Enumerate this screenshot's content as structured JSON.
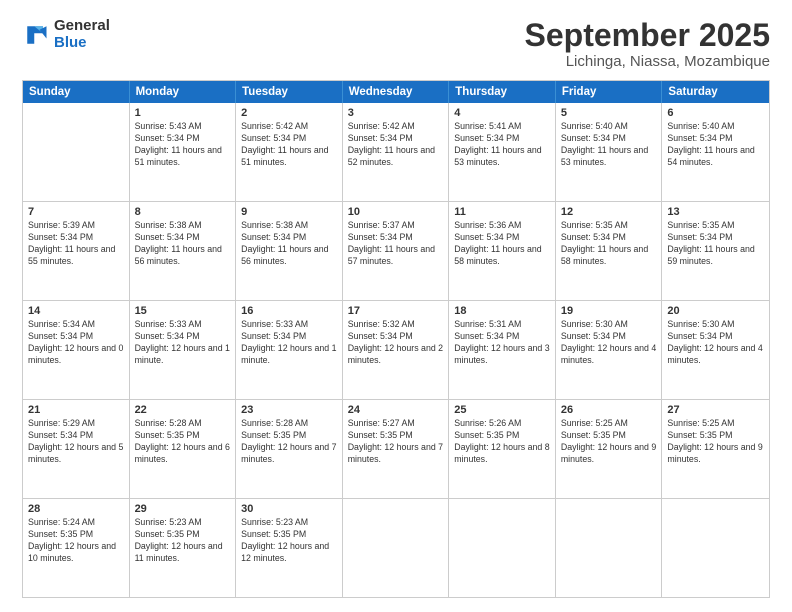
{
  "logo": {
    "general": "General",
    "blue": "Blue"
  },
  "title": {
    "month": "September 2025",
    "location": "Lichinga, Niassa, Mozambique"
  },
  "headers": [
    "Sunday",
    "Monday",
    "Tuesday",
    "Wednesday",
    "Thursday",
    "Friday",
    "Saturday"
  ],
  "rows": [
    [
      {
        "day": "",
        "sunrise": "",
        "sunset": "",
        "daylight": ""
      },
      {
        "day": "1",
        "sunrise": "Sunrise: 5:43 AM",
        "sunset": "Sunset: 5:34 PM",
        "daylight": "Daylight: 11 hours and 51 minutes."
      },
      {
        "day": "2",
        "sunrise": "Sunrise: 5:42 AM",
        "sunset": "Sunset: 5:34 PM",
        "daylight": "Daylight: 11 hours and 51 minutes."
      },
      {
        "day": "3",
        "sunrise": "Sunrise: 5:42 AM",
        "sunset": "Sunset: 5:34 PM",
        "daylight": "Daylight: 11 hours and 52 minutes."
      },
      {
        "day": "4",
        "sunrise": "Sunrise: 5:41 AM",
        "sunset": "Sunset: 5:34 PM",
        "daylight": "Daylight: 11 hours and 53 minutes."
      },
      {
        "day": "5",
        "sunrise": "Sunrise: 5:40 AM",
        "sunset": "Sunset: 5:34 PM",
        "daylight": "Daylight: 11 hours and 53 minutes."
      },
      {
        "day": "6",
        "sunrise": "Sunrise: 5:40 AM",
        "sunset": "Sunset: 5:34 PM",
        "daylight": "Daylight: 11 hours and 54 minutes."
      }
    ],
    [
      {
        "day": "7",
        "sunrise": "Sunrise: 5:39 AM",
        "sunset": "Sunset: 5:34 PM",
        "daylight": "Daylight: 11 hours and 55 minutes."
      },
      {
        "day": "8",
        "sunrise": "Sunrise: 5:38 AM",
        "sunset": "Sunset: 5:34 PM",
        "daylight": "Daylight: 11 hours and 56 minutes."
      },
      {
        "day": "9",
        "sunrise": "Sunrise: 5:38 AM",
        "sunset": "Sunset: 5:34 PM",
        "daylight": "Daylight: 11 hours and 56 minutes."
      },
      {
        "day": "10",
        "sunrise": "Sunrise: 5:37 AM",
        "sunset": "Sunset: 5:34 PM",
        "daylight": "Daylight: 11 hours and 57 minutes."
      },
      {
        "day": "11",
        "sunrise": "Sunrise: 5:36 AM",
        "sunset": "Sunset: 5:34 PM",
        "daylight": "Daylight: 11 hours and 58 minutes."
      },
      {
        "day": "12",
        "sunrise": "Sunrise: 5:35 AM",
        "sunset": "Sunset: 5:34 PM",
        "daylight": "Daylight: 11 hours and 58 minutes."
      },
      {
        "day": "13",
        "sunrise": "Sunrise: 5:35 AM",
        "sunset": "Sunset: 5:34 PM",
        "daylight": "Daylight: 11 hours and 59 minutes."
      }
    ],
    [
      {
        "day": "14",
        "sunrise": "Sunrise: 5:34 AM",
        "sunset": "Sunset: 5:34 PM",
        "daylight": "Daylight: 12 hours and 0 minutes."
      },
      {
        "day": "15",
        "sunrise": "Sunrise: 5:33 AM",
        "sunset": "Sunset: 5:34 PM",
        "daylight": "Daylight: 12 hours and 1 minute."
      },
      {
        "day": "16",
        "sunrise": "Sunrise: 5:33 AM",
        "sunset": "Sunset: 5:34 PM",
        "daylight": "Daylight: 12 hours and 1 minute."
      },
      {
        "day": "17",
        "sunrise": "Sunrise: 5:32 AM",
        "sunset": "Sunset: 5:34 PM",
        "daylight": "Daylight: 12 hours and 2 minutes."
      },
      {
        "day": "18",
        "sunrise": "Sunrise: 5:31 AM",
        "sunset": "Sunset: 5:34 PM",
        "daylight": "Daylight: 12 hours and 3 minutes."
      },
      {
        "day": "19",
        "sunrise": "Sunrise: 5:30 AM",
        "sunset": "Sunset: 5:34 PM",
        "daylight": "Daylight: 12 hours and 4 minutes."
      },
      {
        "day": "20",
        "sunrise": "Sunrise: 5:30 AM",
        "sunset": "Sunset: 5:34 PM",
        "daylight": "Daylight: 12 hours and 4 minutes."
      }
    ],
    [
      {
        "day": "21",
        "sunrise": "Sunrise: 5:29 AM",
        "sunset": "Sunset: 5:34 PM",
        "daylight": "Daylight: 12 hours and 5 minutes."
      },
      {
        "day": "22",
        "sunrise": "Sunrise: 5:28 AM",
        "sunset": "Sunset: 5:35 PM",
        "daylight": "Daylight: 12 hours and 6 minutes."
      },
      {
        "day": "23",
        "sunrise": "Sunrise: 5:28 AM",
        "sunset": "Sunset: 5:35 PM",
        "daylight": "Daylight: 12 hours and 7 minutes."
      },
      {
        "day": "24",
        "sunrise": "Sunrise: 5:27 AM",
        "sunset": "Sunset: 5:35 PM",
        "daylight": "Daylight: 12 hours and 7 minutes."
      },
      {
        "day": "25",
        "sunrise": "Sunrise: 5:26 AM",
        "sunset": "Sunset: 5:35 PM",
        "daylight": "Daylight: 12 hours and 8 minutes."
      },
      {
        "day": "26",
        "sunrise": "Sunrise: 5:25 AM",
        "sunset": "Sunset: 5:35 PM",
        "daylight": "Daylight: 12 hours and 9 minutes."
      },
      {
        "day": "27",
        "sunrise": "Sunrise: 5:25 AM",
        "sunset": "Sunset: 5:35 PM",
        "daylight": "Daylight: 12 hours and 9 minutes."
      }
    ],
    [
      {
        "day": "28",
        "sunrise": "Sunrise: 5:24 AM",
        "sunset": "Sunset: 5:35 PM",
        "daylight": "Daylight: 12 hours and 10 minutes."
      },
      {
        "day": "29",
        "sunrise": "Sunrise: 5:23 AM",
        "sunset": "Sunset: 5:35 PM",
        "daylight": "Daylight: 12 hours and 11 minutes."
      },
      {
        "day": "30",
        "sunrise": "Sunrise: 5:23 AM",
        "sunset": "Sunset: 5:35 PM",
        "daylight": "Daylight: 12 hours and 12 minutes."
      },
      {
        "day": "",
        "sunrise": "",
        "sunset": "",
        "daylight": ""
      },
      {
        "day": "",
        "sunrise": "",
        "sunset": "",
        "daylight": ""
      },
      {
        "day": "",
        "sunrise": "",
        "sunset": "",
        "daylight": ""
      },
      {
        "day": "",
        "sunrise": "",
        "sunset": "",
        "daylight": ""
      }
    ]
  ]
}
